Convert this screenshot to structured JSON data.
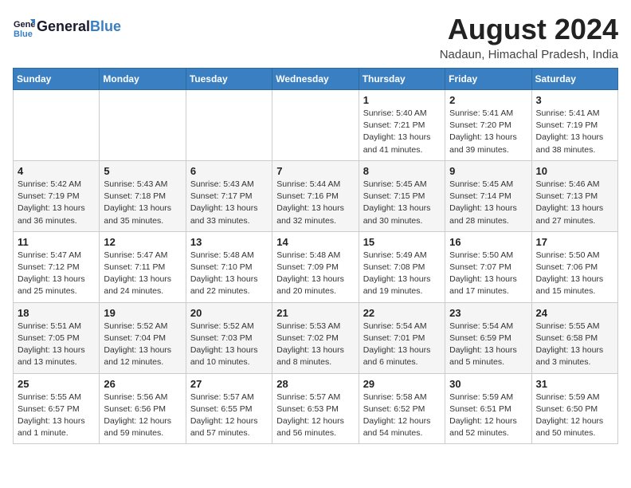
{
  "header": {
    "logo_line1": "General",
    "logo_line2": "Blue",
    "month_title": "August 2024",
    "location": "Nadaun, Himachal Pradesh, India"
  },
  "days_of_week": [
    "Sunday",
    "Monday",
    "Tuesday",
    "Wednesday",
    "Thursday",
    "Friday",
    "Saturday"
  ],
  "weeks": [
    {
      "days": [
        {
          "num": "",
          "detail": ""
        },
        {
          "num": "",
          "detail": ""
        },
        {
          "num": "",
          "detail": ""
        },
        {
          "num": "",
          "detail": ""
        },
        {
          "num": "1",
          "detail": "Sunrise: 5:40 AM\nSunset: 7:21 PM\nDaylight: 13 hours\nand 41 minutes."
        },
        {
          "num": "2",
          "detail": "Sunrise: 5:41 AM\nSunset: 7:20 PM\nDaylight: 13 hours\nand 39 minutes."
        },
        {
          "num": "3",
          "detail": "Sunrise: 5:41 AM\nSunset: 7:19 PM\nDaylight: 13 hours\nand 38 minutes."
        }
      ]
    },
    {
      "days": [
        {
          "num": "4",
          "detail": "Sunrise: 5:42 AM\nSunset: 7:19 PM\nDaylight: 13 hours\nand 36 minutes."
        },
        {
          "num": "5",
          "detail": "Sunrise: 5:43 AM\nSunset: 7:18 PM\nDaylight: 13 hours\nand 35 minutes."
        },
        {
          "num": "6",
          "detail": "Sunrise: 5:43 AM\nSunset: 7:17 PM\nDaylight: 13 hours\nand 33 minutes."
        },
        {
          "num": "7",
          "detail": "Sunrise: 5:44 AM\nSunset: 7:16 PM\nDaylight: 13 hours\nand 32 minutes."
        },
        {
          "num": "8",
          "detail": "Sunrise: 5:45 AM\nSunset: 7:15 PM\nDaylight: 13 hours\nand 30 minutes."
        },
        {
          "num": "9",
          "detail": "Sunrise: 5:45 AM\nSunset: 7:14 PM\nDaylight: 13 hours\nand 28 minutes."
        },
        {
          "num": "10",
          "detail": "Sunrise: 5:46 AM\nSunset: 7:13 PM\nDaylight: 13 hours\nand 27 minutes."
        }
      ]
    },
    {
      "days": [
        {
          "num": "11",
          "detail": "Sunrise: 5:47 AM\nSunset: 7:12 PM\nDaylight: 13 hours\nand 25 minutes."
        },
        {
          "num": "12",
          "detail": "Sunrise: 5:47 AM\nSunset: 7:11 PM\nDaylight: 13 hours\nand 24 minutes."
        },
        {
          "num": "13",
          "detail": "Sunrise: 5:48 AM\nSunset: 7:10 PM\nDaylight: 13 hours\nand 22 minutes."
        },
        {
          "num": "14",
          "detail": "Sunrise: 5:48 AM\nSunset: 7:09 PM\nDaylight: 13 hours\nand 20 minutes."
        },
        {
          "num": "15",
          "detail": "Sunrise: 5:49 AM\nSunset: 7:08 PM\nDaylight: 13 hours\nand 19 minutes."
        },
        {
          "num": "16",
          "detail": "Sunrise: 5:50 AM\nSunset: 7:07 PM\nDaylight: 13 hours\nand 17 minutes."
        },
        {
          "num": "17",
          "detail": "Sunrise: 5:50 AM\nSunset: 7:06 PM\nDaylight: 13 hours\nand 15 minutes."
        }
      ]
    },
    {
      "days": [
        {
          "num": "18",
          "detail": "Sunrise: 5:51 AM\nSunset: 7:05 PM\nDaylight: 13 hours\nand 13 minutes."
        },
        {
          "num": "19",
          "detail": "Sunrise: 5:52 AM\nSunset: 7:04 PM\nDaylight: 13 hours\nand 12 minutes."
        },
        {
          "num": "20",
          "detail": "Sunrise: 5:52 AM\nSunset: 7:03 PM\nDaylight: 13 hours\nand 10 minutes."
        },
        {
          "num": "21",
          "detail": "Sunrise: 5:53 AM\nSunset: 7:02 PM\nDaylight: 13 hours\nand 8 minutes."
        },
        {
          "num": "22",
          "detail": "Sunrise: 5:54 AM\nSunset: 7:01 PM\nDaylight: 13 hours\nand 6 minutes."
        },
        {
          "num": "23",
          "detail": "Sunrise: 5:54 AM\nSunset: 6:59 PM\nDaylight: 13 hours\nand 5 minutes."
        },
        {
          "num": "24",
          "detail": "Sunrise: 5:55 AM\nSunset: 6:58 PM\nDaylight: 13 hours\nand 3 minutes."
        }
      ]
    },
    {
      "days": [
        {
          "num": "25",
          "detail": "Sunrise: 5:55 AM\nSunset: 6:57 PM\nDaylight: 13 hours\nand 1 minute."
        },
        {
          "num": "26",
          "detail": "Sunrise: 5:56 AM\nSunset: 6:56 PM\nDaylight: 12 hours\nand 59 minutes."
        },
        {
          "num": "27",
          "detail": "Sunrise: 5:57 AM\nSunset: 6:55 PM\nDaylight: 12 hours\nand 57 minutes."
        },
        {
          "num": "28",
          "detail": "Sunrise: 5:57 AM\nSunset: 6:53 PM\nDaylight: 12 hours\nand 56 minutes."
        },
        {
          "num": "29",
          "detail": "Sunrise: 5:58 AM\nSunset: 6:52 PM\nDaylight: 12 hours\nand 54 minutes."
        },
        {
          "num": "30",
          "detail": "Sunrise: 5:59 AM\nSunset: 6:51 PM\nDaylight: 12 hours\nand 52 minutes."
        },
        {
          "num": "31",
          "detail": "Sunrise: 5:59 AM\nSunset: 6:50 PM\nDaylight: 12 hours\nand 50 minutes."
        }
      ]
    }
  ]
}
